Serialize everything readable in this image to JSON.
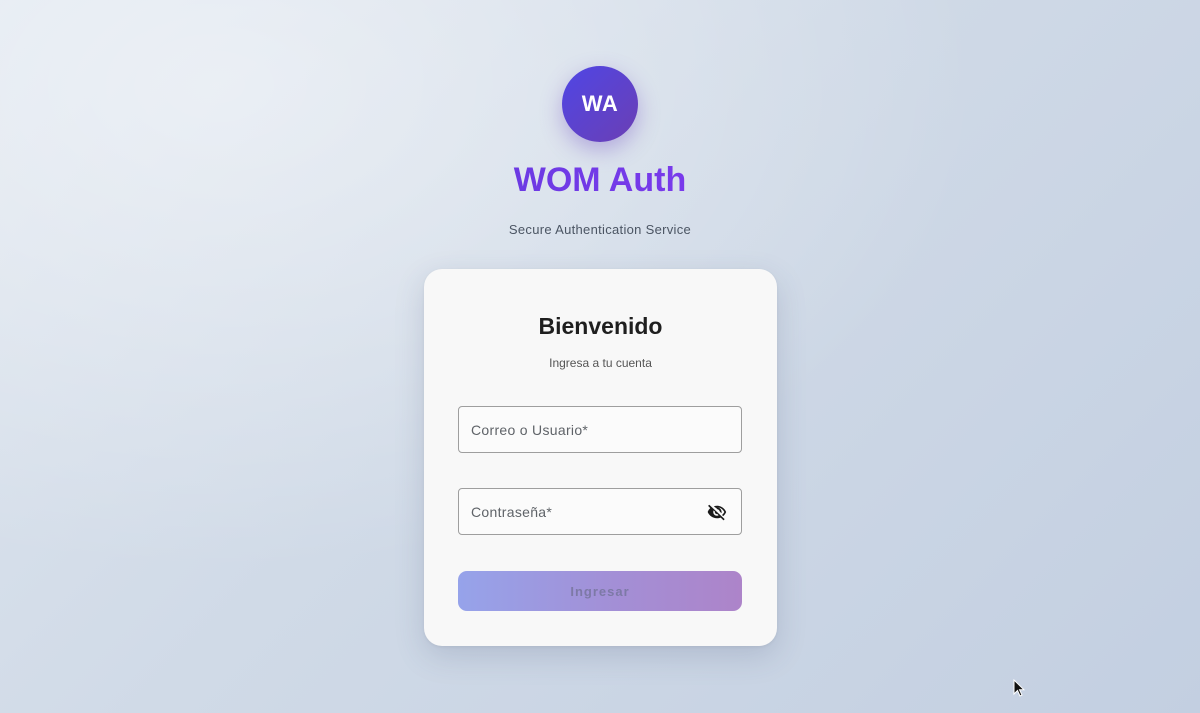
{
  "brand": {
    "logo_initials": "WA",
    "title": "WOM Auth",
    "subtitle": "Secure Authentication Service"
  },
  "login_card": {
    "title": "Bienvenido",
    "subtitle": "Ingresa a tu cuenta",
    "username_field": {
      "placeholder": "Correo o Usuario*",
      "value": ""
    },
    "password_field": {
      "placeholder": "Contraseña*",
      "value": "",
      "visibility_icon": "eye-off-icon"
    },
    "submit_label": "Ingresar",
    "submit_disabled": true
  },
  "colors": {
    "brand_primary": "#4f46e5",
    "brand_secondary": "#7c3aed",
    "card_background": "#f8f8f8",
    "page_background": "#d0dae7"
  }
}
